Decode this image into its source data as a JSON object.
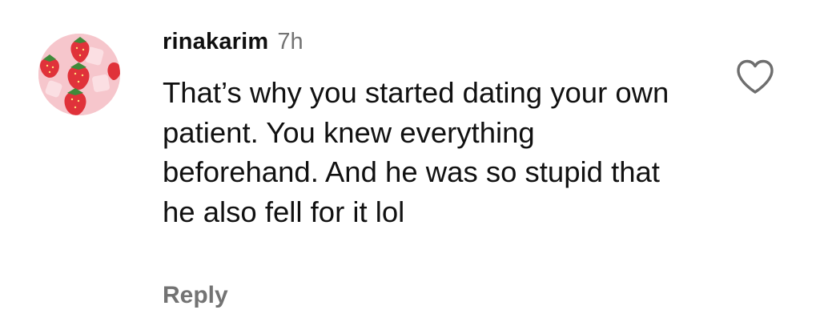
{
  "comment": {
    "username": "rinakarim",
    "timestamp": "7h",
    "text": "That’s why you started dating your own patient. You knew everything beforehand. And he was so stupid that he also fell for it lol",
    "reply_label": "Reply",
    "avatar_icon": "avatar-strawberries",
    "like_icon": "heart-outline-icon"
  },
  "colors": {
    "text": "#111111",
    "secondary_text": "#737373",
    "background": "#ffffff",
    "avatar_bg": "#f6c6cc",
    "strawberry": "#e0323a"
  }
}
